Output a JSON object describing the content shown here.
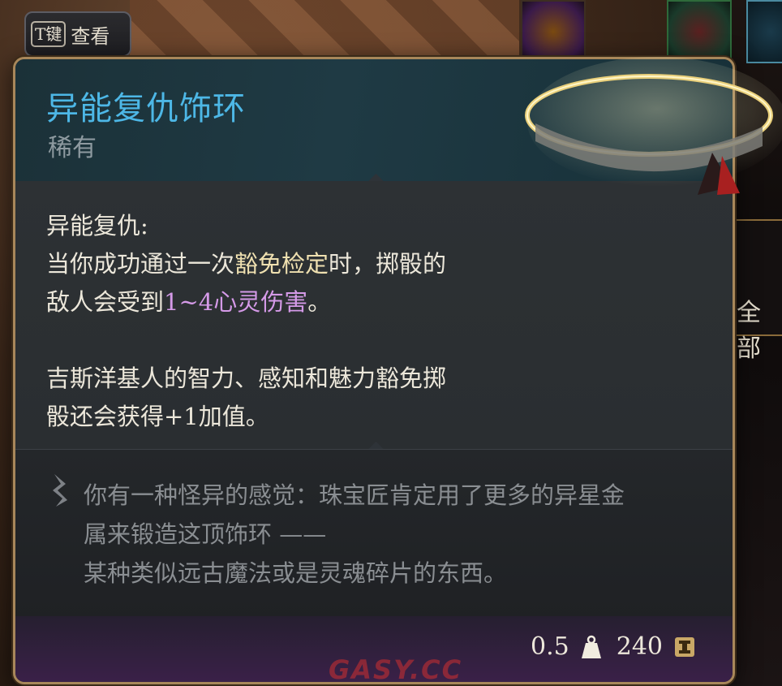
{
  "hint": {
    "key": "T键",
    "action": "查看"
  },
  "item": {
    "name": "异能复仇饰环",
    "rarity": "稀有",
    "effect_title": "异能复仇:",
    "effect_line1_a": "当你成功通过一次",
    "effect_line1_hl": "豁免检定",
    "effect_line1_b": "时，掷骰的",
    "effect_line2_a": "敌人会受到",
    "effect_line2_hl": "1~4心灵伤害",
    "effect_line2_b": "。",
    "passive_line1": "吉斯洋基人的智力、感知和魅力豁免掷",
    "passive_line2": "骰还会获得+1加值。",
    "lore_line1": "你有一种怪异的感觉：珠宝匠肯定用了更多的异星金",
    "lore_line2": "属来锻造这顶饰环 ——",
    "lore_line3": "某种类似远古魔法或是灵魂碎片的东西。",
    "weight": "0.5",
    "value": "240"
  },
  "side": {
    "label": "全部"
  },
  "watermark": "GASY.CC",
  "icons": {
    "weight": "weight-icon",
    "gold": "gold-icon",
    "lore": "lore-quill-icon"
  },
  "colors": {
    "title": "#4db7e6",
    "highlight_yellow": "#efe0b0",
    "highlight_purple": "#d59ae8",
    "border": "#a8875a"
  }
}
